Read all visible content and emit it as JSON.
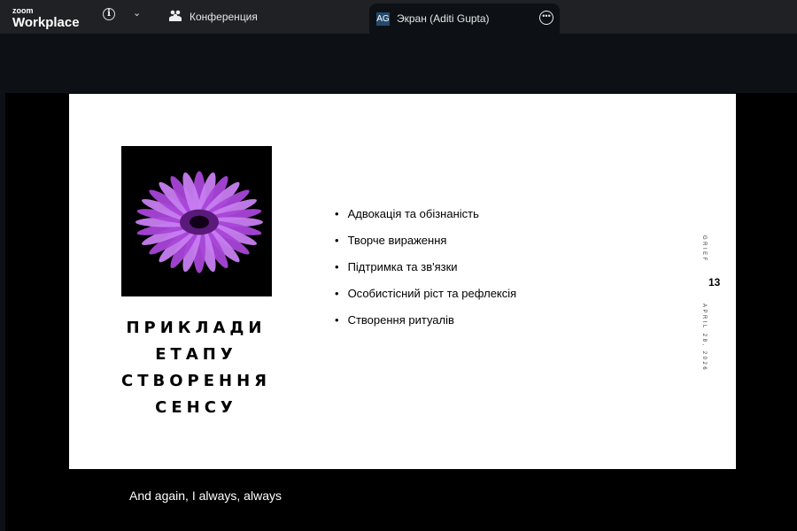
{
  "topbar": {
    "logo_small": "zoom",
    "logo_large": "Workplace",
    "tabs": [
      {
        "label": "Конференция",
        "icon": "participants-icon"
      },
      {
        "label": "Экран (Aditi Gupta)",
        "avatar": "AG",
        "active": true
      }
    ]
  },
  "slide": {
    "title_lines": [
      "ПРИКЛАДИ",
      "ЕТАПУ",
      "СТВОРЕННЯ",
      "СЕНСУ"
    ],
    "bullets": [
      "Адвокація та обізнаність",
      "Творче вираження",
      "Підтримка та зв'язки",
      "Особистісний ріст та рефлексія",
      "Створення ритуалів"
    ],
    "side_top": "GRIEF",
    "page_number": "13",
    "side_date": "APRIL 28, 2026"
  },
  "caption": "And again, I always, always",
  "colors": {
    "petal": "#b04fe0",
    "topbar": "#1f2124"
  }
}
